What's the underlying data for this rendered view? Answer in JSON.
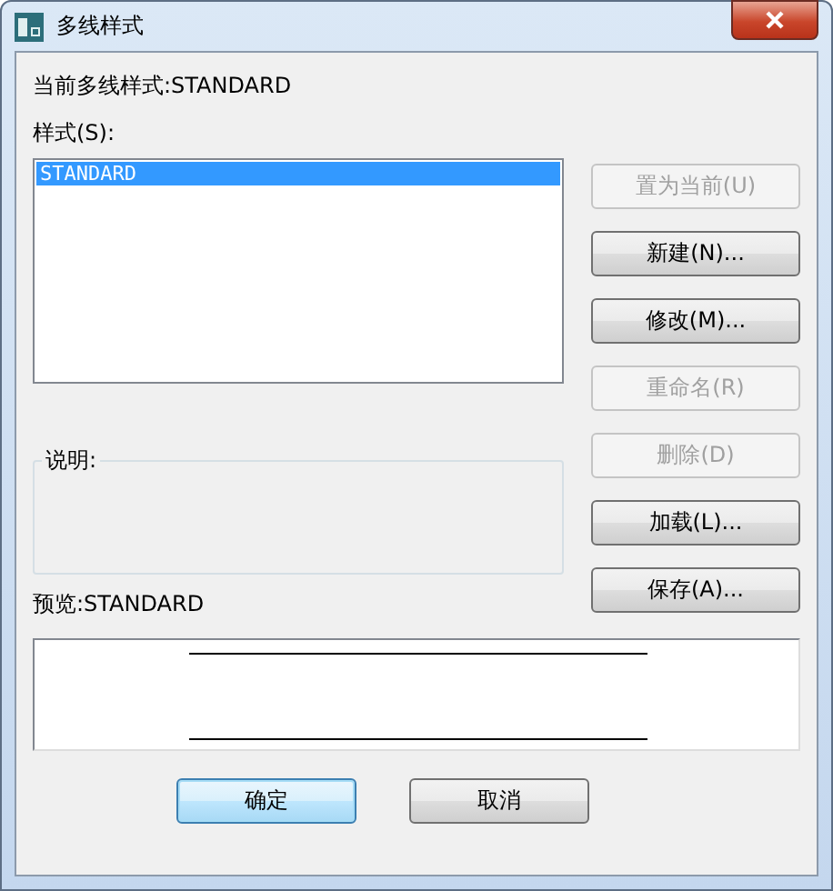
{
  "window": {
    "title": "多线样式"
  },
  "current_style": "当前多线样式:STANDARD",
  "styles_label": "样式(S):",
  "styles": [
    {
      "name": "STANDARD",
      "selected": true
    }
  ],
  "side_buttons": [
    {
      "label": "置为当前(U)",
      "disabled": true
    },
    {
      "label": "新建(N)...",
      "disabled": false
    },
    {
      "label": "修改(M)...",
      "disabled": false
    },
    {
      "label": "重命名(R)",
      "disabled": true
    },
    {
      "label": "删除(D)",
      "disabled": true
    },
    {
      "label": "加载(L)...",
      "disabled": false
    },
    {
      "label": "保存(A)...",
      "disabled": false
    }
  ],
  "description": {
    "label": "说明:"
  },
  "preview": {
    "label": "预览:STANDARD"
  },
  "dialog_buttons": [
    {
      "label": "确定",
      "default": true
    },
    {
      "label": "取消",
      "default": false
    }
  ]
}
